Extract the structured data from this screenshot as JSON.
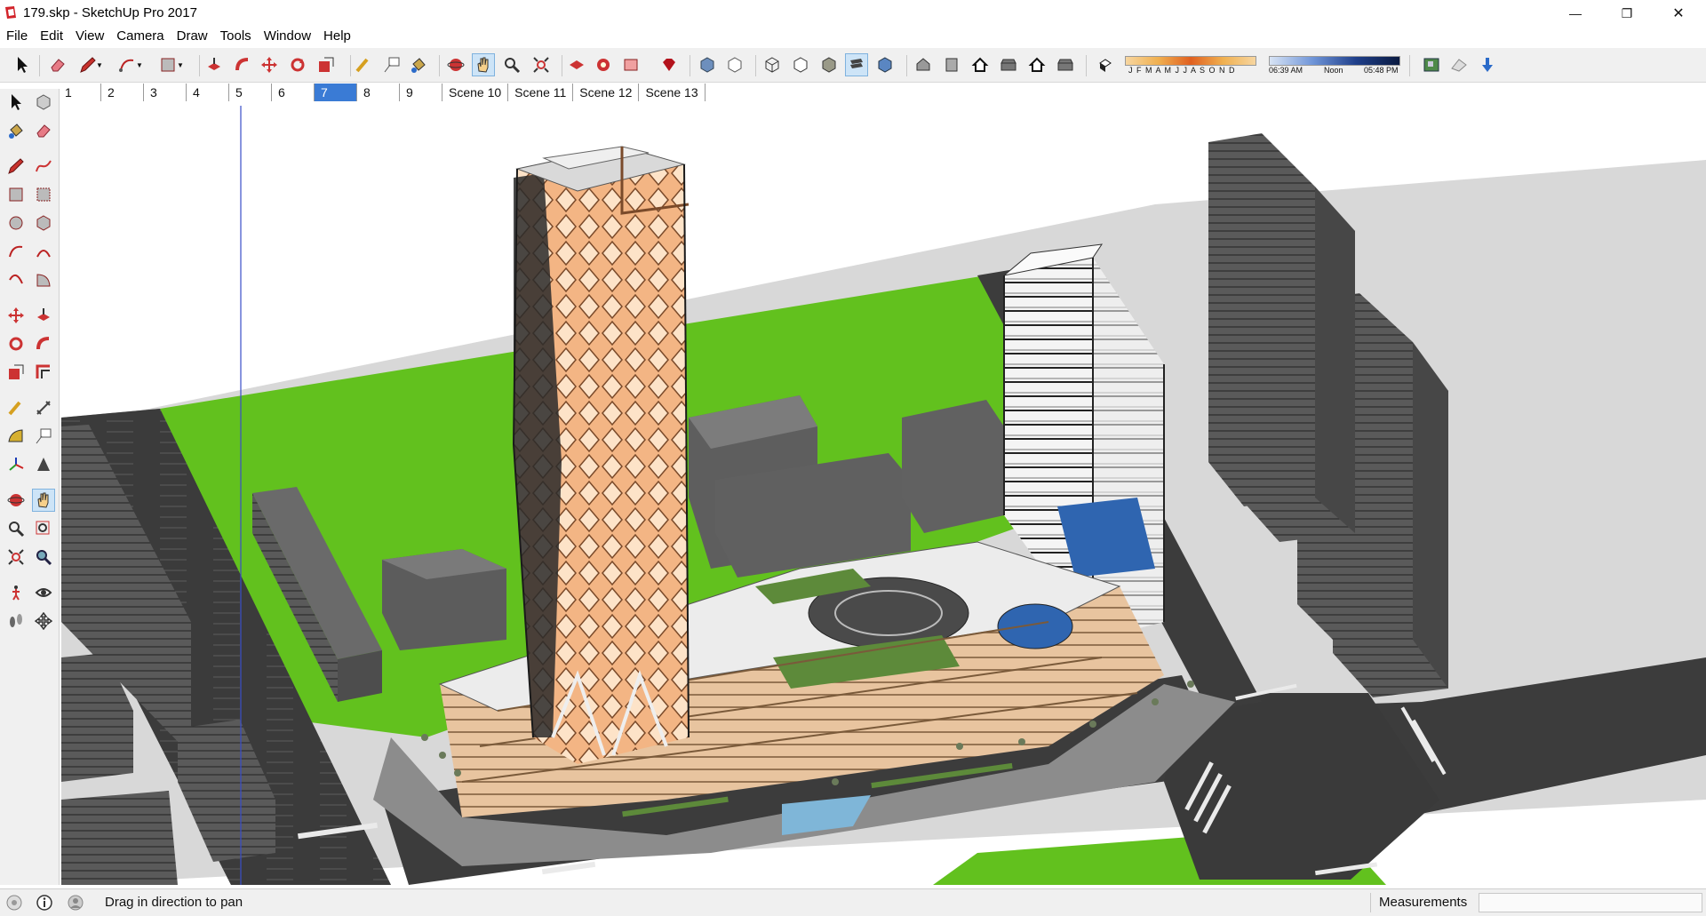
{
  "window": {
    "title": "179.skp - SketchUp Pro 2017",
    "minimize_glyph": "—",
    "restore_glyph": "❐",
    "close_glyph": "✕"
  },
  "menu": [
    "File",
    "Edit",
    "View",
    "Camera",
    "Draw",
    "Tools",
    "Window",
    "Help"
  ],
  "toolbar": {
    "shadow_months": "J F M A M J J A S O N D",
    "time_start": "06:39 AM",
    "time_mid": "Noon",
    "time_end": "05:48 PM"
  },
  "scenes": [
    "1",
    "2",
    "3",
    "4",
    "5",
    "6",
    "7",
    "8",
    "9",
    "Scene 10",
    "Scene 11",
    "Scene 12",
    "Scene 13"
  ],
  "active_scene": "7",
  "status": {
    "hint": "Drag in direction to pan",
    "measurements_label": "Measurements",
    "measurements_value": ""
  },
  "colors": {
    "grass": "#62c11e",
    "road": "#3c3c3c",
    "tower": "#f2b07a",
    "massing": "#6a6a6a",
    "accent_blue": "#3a7bd5"
  }
}
